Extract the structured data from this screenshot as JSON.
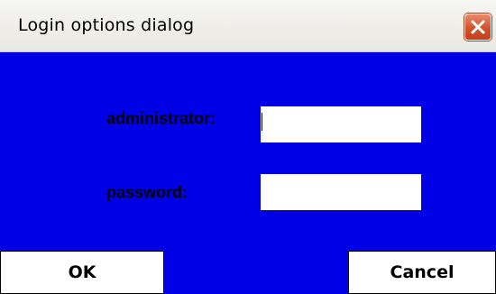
{
  "window": {
    "title": "Login options dialog",
    "close_icon": "close-icon"
  },
  "form": {
    "administrator_label": "administrator:",
    "administrator_value": "",
    "password_label": "password:",
    "password_value": ""
  },
  "buttons": {
    "ok_label": "OK",
    "cancel_label": "Cancel"
  },
  "colors": {
    "client_background": "#0000e6",
    "close_button": "#d2512d"
  }
}
